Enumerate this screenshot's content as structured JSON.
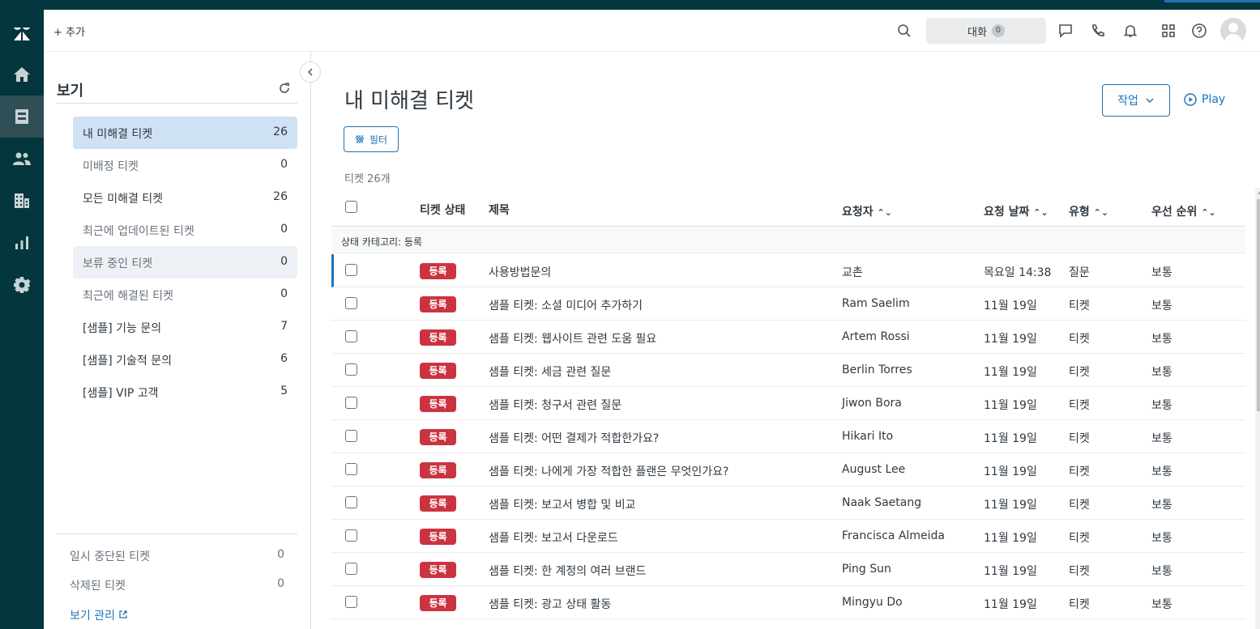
{
  "topbar": {
    "add_label": "+ 추가",
    "conversations_label": "대화",
    "conversations_count": "0"
  },
  "nav": {
    "icons": [
      "zendesk-logo-icon",
      "home-icon",
      "views-icon",
      "customers-icon",
      "organizations-icon",
      "reporting-icon",
      "admin-gear-icon"
    ]
  },
  "views_panel": {
    "title": "보기",
    "items": [
      {
        "label": "내 미해결 티켓",
        "count": "26"
      },
      {
        "label": "미배정 티켓",
        "count": "0"
      },
      {
        "label": "모든 미해결 티켓",
        "count": "26"
      },
      {
        "label": "최근에 업데이트된 티켓",
        "count": "0"
      },
      {
        "label": "보류 중인 티켓",
        "count": "0"
      },
      {
        "label": "최근에 해결된 티켓",
        "count": "0"
      },
      {
        "label": "[샘플] 기능 문의",
        "count": "7"
      },
      {
        "label": "[샘플] 기술적 문의",
        "count": "6"
      },
      {
        "label": "[샘플] VIP 고객",
        "count": "5"
      }
    ],
    "bottom_items": [
      {
        "label": "일시 중단된 티켓",
        "count": "0"
      },
      {
        "label": "삭제된 티켓",
        "count": "0"
      }
    ],
    "manage_label": "보기 관리"
  },
  "main": {
    "title": "내 미해결 티켓",
    "work_label": "작업",
    "play_label": "Play",
    "filter_label": "필터",
    "ticket_count": "티켓 26개"
  },
  "table": {
    "headers": {
      "status": "티켓 상태",
      "subject": "제목",
      "requester": "요청자",
      "requested": "요청 날짜",
      "type": "유형",
      "priority": "우선 순위"
    },
    "group_label": "상태 카테고리: 등록",
    "rows": [
      {
        "status": "등록",
        "subject": "사용방법문의",
        "requester": "교촌",
        "date": "목요일 14:38",
        "type": "질문",
        "priority": "보통"
      },
      {
        "status": "등록",
        "subject": "샘플 티켓: 소셜 미디어 추가하기",
        "requester": "Ram Saelim",
        "date": "11월 19일",
        "type": "티켓",
        "priority": "보통"
      },
      {
        "status": "등록",
        "subject": "샘플 티켓: 웹사이트 관련 도움 필요",
        "requester": "Artem Rossi",
        "date": "11월 19일",
        "type": "티켓",
        "priority": "보통"
      },
      {
        "status": "등록",
        "subject": "샘플 티켓: 세금 관련 질문",
        "requester": "Berlin Torres",
        "date": "11월 19일",
        "type": "티켓",
        "priority": "보통"
      },
      {
        "status": "등록",
        "subject": "샘플 티켓: 청구서 관련 질문",
        "requester": "Jiwon Bora",
        "date": "11월 19일",
        "type": "티켓",
        "priority": "보통"
      },
      {
        "status": "등록",
        "subject": "샘플 티켓: 어떤 결제가 적합한가요?",
        "requester": "Hikari Ito",
        "date": "11월 19일",
        "type": "티켓",
        "priority": "보통"
      },
      {
        "status": "등록",
        "subject": "샘플 티켓: 나에게 가장 적합한 플랜은 무엇인가요?",
        "requester": "August Lee",
        "date": "11월 19일",
        "type": "티켓",
        "priority": "보통"
      },
      {
        "status": "등록",
        "subject": "샘플 티켓: 보고서 병합 및 비교",
        "requester": "Naak Saetang",
        "date": "11월 19일",
        "type": "티켓",
        "priority": "보통"
      },
      {
        "status": "등록",
        "subject": "샘플 티켓: 보고서 다운로드",
        "requester": "Francisca Almeida",
        "date": "11월 19일",
        "type": "티켓",
        "priority": "보통"
      },
      {
        "status": "등록",
        "subject": "샘플 티켓: 한 계정의 여러 브랜드",
        "requester": "Ping Sun",
        "date": "11월 19일",
        "type": "티켓",
        "priority": "보통"
      },
      {
        "status": "등록",
        "subject": "샘플 티켓: 광고 상태 활동",
        "requester": "Mingyu Do",
        "date": "11월 19일",
        "type": "티켓",
        "priority": "보통"
      }
    ]
  },
  "colors": {
    "rail": "#03363d",
    "accent": "#1f73b7",
    "status_new": "#cc3340",
    "selected_view": "#cfe2f3"
  }
}
